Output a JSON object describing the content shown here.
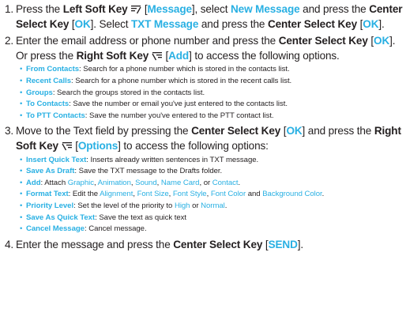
{
  "colors": {
    "accent": "#29b0e3",
    "text": "#231f20"
  },
  "steps": [
    {
      "num": "1.",
      "t1": "Press the ",
      "k1": "Left Soft Key",
      "icon1": "left-soft-key-icon",
      "br1o": " [",
      "o1": "Message",
      "br1c": "], select ",
      "o2": "New Message",
      "t2": " and press the ",
      "k2": "Center Select Key",
      "br2o": " [",
      "o3": "OK",
      "br2c": "]. Select ",
      "o4": "TXT Message",
      "t3": " and press the ",
      "k3": "Center Select Key",
      "br3o": " [",
      "o5": "OK",
      "br3c": "]."
    },
    {
      "num": "2.",
      "t1": "Enter the email address or phone number and press the ",
      "k1": "Center Select Key",
      "br1o": " [",
      "o1": "OK",
      "t2": "]. Or press the ",
      "k2": "Right Soft Key",
      "icon1": "right-soft-key-icon",
      "br2o": " [",
      "o2": "Add",
      "br2c": "] to access the following options.",
      "items": [
        {
          "term": "From Contacts",
          "text": ": Search for a phone number which is stored in the contacts list."
        },
        {
          "term": "Recent Calls",
          "text": ": Search for a phone number which is stored in the recent calls list."
        },
        {
          "term": "Groups",
          "text": ": Search the groups stored in the contacts list."
        },
        {
          "term": "To Contacts",
          "text": ": Save the number or email you've just entered to the contacts list."
        },
        {
          "term": "To PTT Contacts",
          "text": ": Save the number you've entered to the PTT contact list."
        }
      ]
    },
    {
      "num": "3.",
      "t1": "Move to the Text field by pressing the ",
      "k1": "Center Select Key",
      "br1o": " [",
      "o1": "OK",
      "br1c": "] and press the ",
      "k2": "Right Soft Key",
      "icon1": "right-soft-key-icon",
      "br2o": " [",
      "o2": "Options",
      "br2c": "] to access the following options:",
      "items": {
        "quick": {
          "term": "Insert Quick Text",
          "text": ": Inserts already written sentences in TXT message."
        },
        "draft": {
          "term": "Save As Draft",
          "text": ": Save the TXT message to the Drafts folder."
        },
        "add": {
          "term": "Add",
          "pre": ": Attach ",
          "a": "Graphic",
          "s1": ", ",
          "b": "Animation",
          "s2": ", ",
          "c": "Sound",
          "s3": ", ",
          "d": "Name Card",
          "s4": ", or ",
          "e": "Contact",
          "s5": "."
        },
        "format": {
          "term": "Format Text",
          "pre": ": Edit the ",
          "a": "Alignment",
          "s1": ", ",
          "b": "Font Size",
          "s2": ", ",
          "c": "Font Style",
          "s3": ", ",
          "d": "Font Color",
          "s4": " and ",
          "e": "Background Color",
          "s5": "."
        },
        "priority": {
          "term": "Priority Level",
          "pre": ": Set the level of the priority to ",
          "a": "High",
          "s1": " or ",
          "b": "Normal",
          "s2": "."
        },
        "save_quick": {
          "term": "Save As Quick Text",
          "text": ": Save the text as quick text"
        },
        "cancel": {
          "term": "Cancel Message",
          "text": ": Cancel message."
        }
      }
    },
    {
      "num": "4.",
      "t1": "Enter the message and press the ",
      "k1": "Center Select Key",
      "br1o": " [",
      "o1": "SEND",
      "br1c": "]."
    }
  ]
}
